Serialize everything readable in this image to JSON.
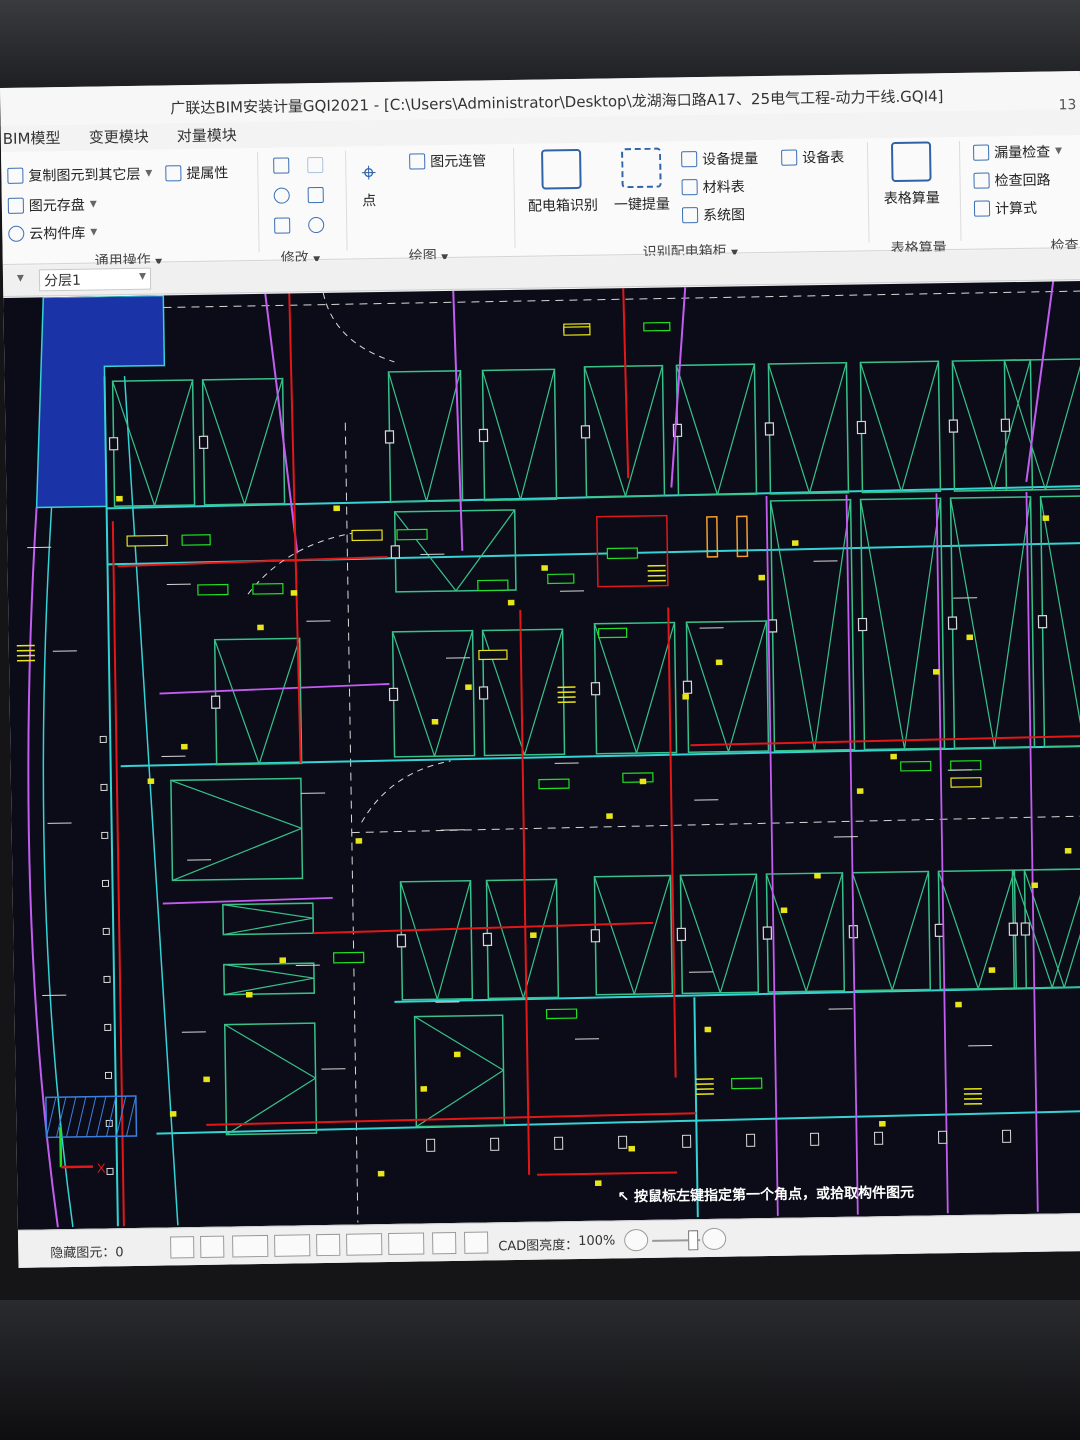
{
  "window": {
    "title": "广联达BIM安装计量GQI2021 - [C:\\Users\\Administrator\\Desktop\\龙湖海口路A17、25电气工程-动力干线.GQI4]",
    "corner_number": "13"
  },
  "tabs": [
    "BIM模型",
    "变更模块",
    "对量模块"
  ],
  "ribbon": {
    "common": {
      "copy_to_layer": "复制图元到其它层",
      "properties": "提属性",
      "save_elements": "图元存盘",
      "cloud_library": "云构件库",
      "group_label": "通用操作"
    },
    "modify": {
      "group_label": "修改"
    },
    "draw": {
      "point": "点",
      "pipe_connect": "图元连管",
      "group_label": "绘图"
    },
    "distribution_box": {
      "identify": "配电箱识别",
      "one_click": "一键提量",
      "device_extract": "设备提量",
      "device_table": "设备表",
      "material_table": "材料表",
      "system_diagram": "系统图",
      "group_label": "识别配电箱柜"
    },
    "table_calc": {
      "label": "表格算量",
      "group_label": "表格算量"
    },
    "check": {
      "missing_check": "漏量检查",
      "check_circuit": "检查回路",
      "formula": "计算式",
      "group_label": "检查"
    }
  },
  "layer_selector": {
    "value": "分层1"
  },
  "canvas": {
    "hint": "按鼠标左键指定第一个角点，或拾取构件图元",
    "axis_x": "X",
    "colors": {
      "background": "#0b0c18",
      "wall": "#35d3d3",
      "stall": "#38c28a",
      "red_line": "#e01818",
      "magenta_line": "#c35cf0",
      "yellow_tag": "#e8e51a",
      "green_tag": "#22e022",
      "white": "#d8d8d8"
    },
    "icons": [
      "grid-icon",
      "axis-icon"
    ]
  },
  "status": {
    "hidden_elements": "隐藏图元：0",
    "cad_brightness_label": "CAD图亮度：",
    "cad_brightness_value": "100%"
  }
}
